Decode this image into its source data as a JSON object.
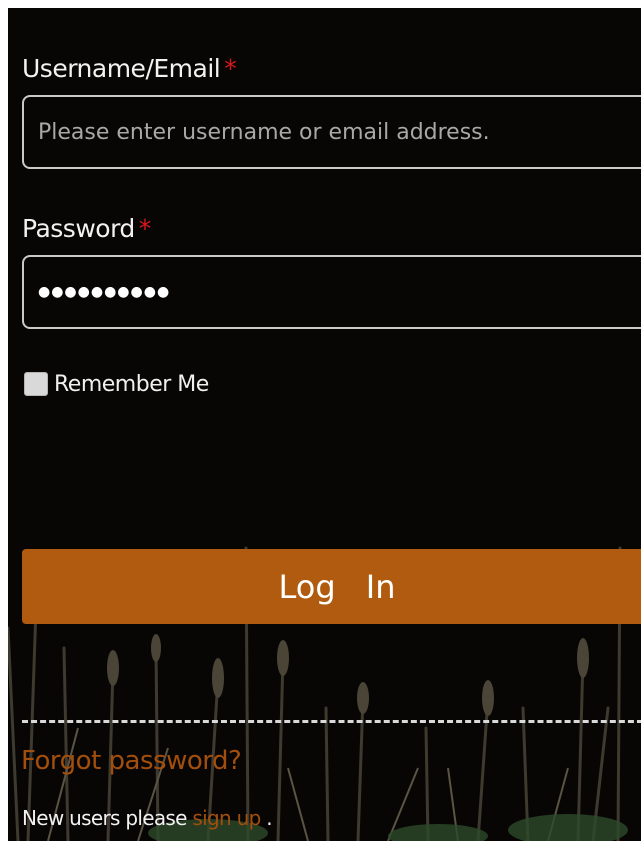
{
  "form": {
    "username_label": "Username/Email",
    "password_label": "Password",
    "required_marker": "*",
    "username_placeholder": "Please enter username or email address.",
    "password_value": "●●●●●●●●●●",
    "remember_label": "Remember Me",
    "remember_checked": false,
    "login_button": "Log In"
  },
  "footer": {
    "forgot_password": "Forgot password?",
    "new_users_text": "New users please",
    "signup_link": "sign up",
    "trailing": "."
  },
  "colors": {
    "background": "#080605",
    "accent": "#b05b0f",
    "link": "#a24e0c",
    "required": "#d81818"
  }
}
